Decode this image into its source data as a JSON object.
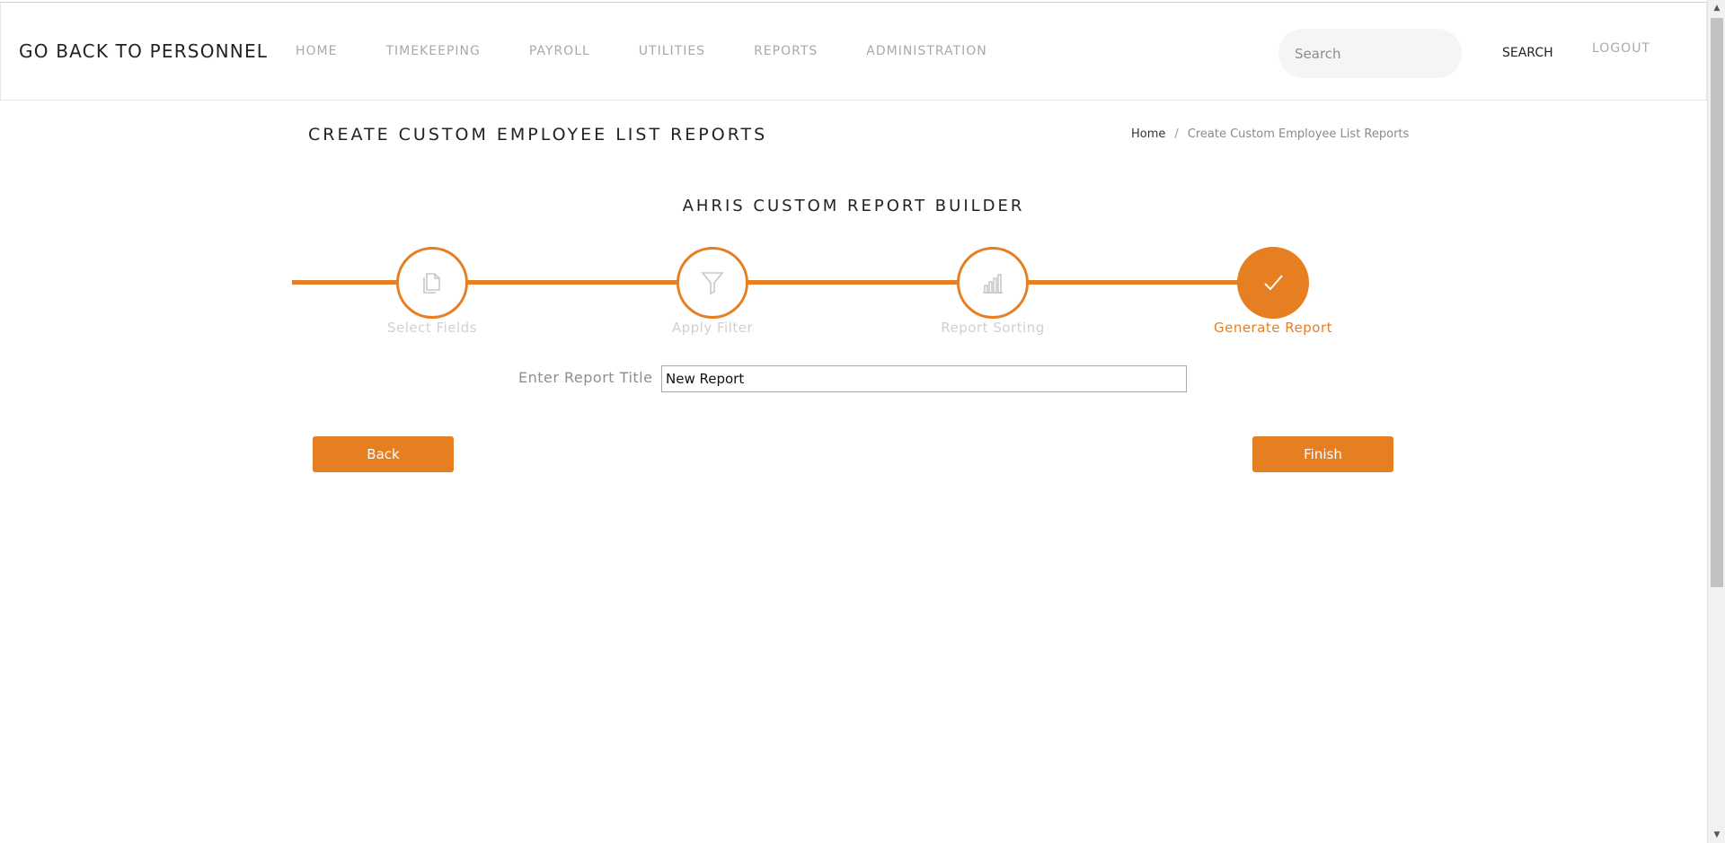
{
  "header": {
    "brand": "GO BACK TO PERSONNEL",
    "nav": [
      "HOME",
      "TIMEKEEPING",
      "PAYROLL",
      "UTILITIES",
      "REPORTS",
      "ADMINISTRATION"
    ],
    "search_placeholder": "Search",
    "search_button": "SEARCH",
    "logout": "LOGOUT"
  },
  "page": {
    "title": "CREATE CUSTOM EMPLOYEE LIST REPORTS",
    "breadcrumb": {
      "home": "Home",
      "separator": "/",
      "current": "Create Custom Employee List Reports"
    }
  },
  "builder": {
    "title": "AHRIS CUSTOM REPORT BUILDER",
    "steps": [
      {
        "label": "Select Fields",
        "icon": "copy-document-icon",
        "active": false
      },
      {
        "label": "Apply Filter",
        "icon": "filter-funnel-icon",
        "active": false
      },
      {
        "label": "Report Sorting",
        "icon": "bar-chart-icon",
        "active": false
      },
      {
        "label": "Generate Report",
        "icon": "checkmark-icon",
        "active": true
      }
    ],
    "current_step": 4,
    "accent_color": "#e67e22"
  },
  "form": {
    "report_title_label": "Enter Report Title",
    "report_title_value": "New Report"
  },
  "actions": {
    "back": "Back",
    "finish": "Finish"
  }
}
